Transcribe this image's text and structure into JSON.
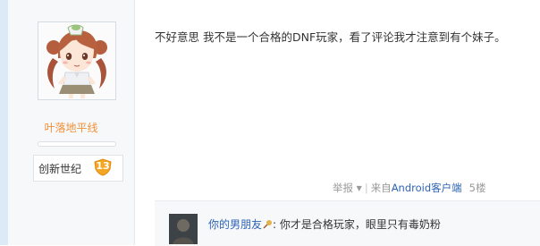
{
  "author": {
    "username": "叶落地平线",
    "badge": {
      "name": "创新世纪",
      "level": "13"
    }
  },
  "post": {
    "content": "不好意思 我不是一个合格的DNF玩家，看了评论我才注意到有个妹子。"
  },
  "tail": {
    "report": "举报",
    "source_prefix": "来自",
    "source_client": "Android客户端",
    "floor_partial": "5楼"
  },
  "reply": {
    "user": "你的男朋友",
    "separator": ":",
    "text": " 你才是合格玩家，眼里只有毒奶粉"
  },
  "icons": {
    "avatar": "anime-girl-avatar",
    "badge": "level-shield-icon",
    "report_caret": "caret-down-icon",
    "user_decoration": "pen-icon"
  },
  "colors": {
    "username": "#f0913b",
    "link": "#2d64b3",
    "badge": "#f5a623"
  }
}
